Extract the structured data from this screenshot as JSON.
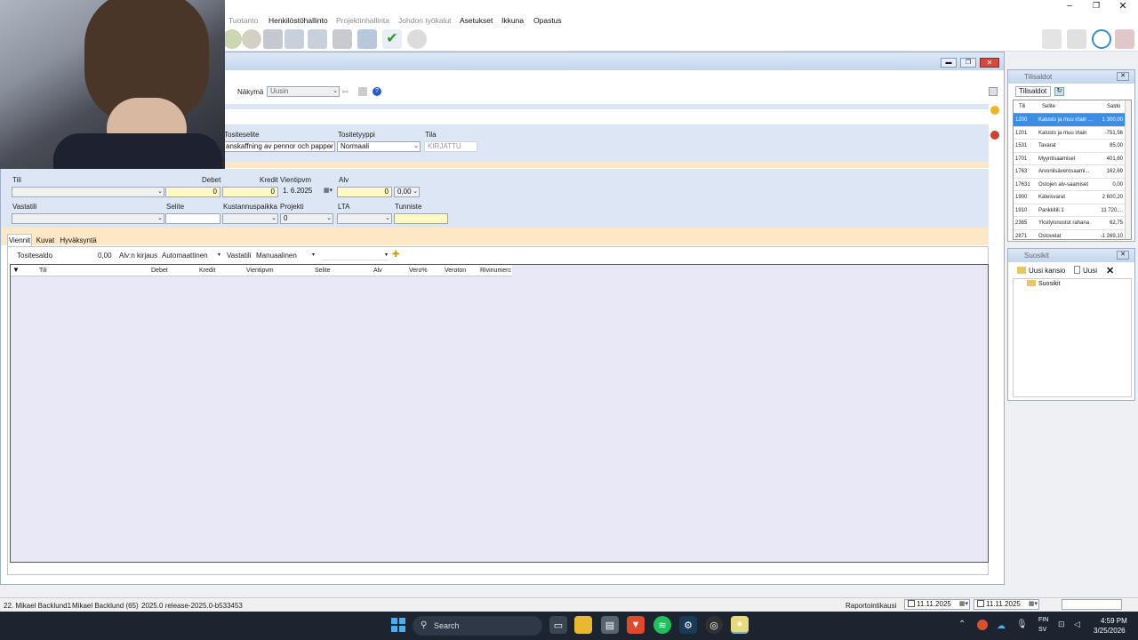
{
  "menu": [
    {
      "label": "Tuotanto",
      "enabled": false
    },
    {
      "label": "Henkilöstöhallinto",
      "enabled": true
    },
    {
      "label": "Projektinhallinta",
      "enabled": false
    },
    {
      "label": "Johdon työkalut",
      "enabled": false
    },
    {
      "label": "Asetukset",
      "enabled": true
    },
    {
      "label": "Ikkuna",
      "enabled": true
    },
    {
      "label": "Opastus",
      "enabled": true
    }
  ],
  "view": {
    "label": "Näkymä",
    "value": "Uusin"
  },
  "voucher": {
    "desc_label": "Tositeselite",
    "desc_value": "anskaffning av pennor och papper",
    "type_label": "Tositetyyppi",
    "type_value": "Normaali",
    "state_label": "Tila",
    "state_value": "KIRJATTU"
  },
  "entry": {
    "account_label": "Tili",
    "debit_label": "Debet",
    "debit_value": "0",
    "credit_label": "Kredit",
    "credit_value": "0",
    "date_label": "Vientipvm",
    "date_value": "1.  6.2025",
    "vat_label": "Alv",
    "vat_value": "0",
    "vat_pct": "0,00",
    "offset_label": "Vastatili",
    "desc_label": "Selite",
    "cost_center_label": "Kustannuspaikka",
    "project_label": "Projekti",
    "project_value": "0",
    "lta_label": "LTA",
    "tag_label": "Tunniste"
  },
  "tabs": [
    "Viennit",
    "Kuvat",
    "Hyväksyntä"
  ],
  "toolbar2": {
    "balance_label": "Tositesaldo",
    "balance_value": "0,00",
    "vat_posting_label": "Alv:n kirjaus",
    "vat_posting_value": "Automaattinen",
    "offset_label": "Vastatili",
    "offset_value": "Manuaalinen"
  },
  "grid_columns": [
    "Tili",
    "Debet",
    "Kredit",
    "Vientipvm",
    "Selite",
    "Alv",
    "Vero%",
    "Veroton",
    "Rivinumerc"
  ],
  "balances_panel": {
    "title": "Tilisaldot",
    "tab": "Tilisaldot",
    "columns": [
      "Tili",
      "Selite",
      "Saldo"
    ],
    "rows": [
      {
        "acc": "1200",
        "desc": "Kalusto ja muu irtain ...",
        "bal": "1 300,00",
        "selected": true
      },
      {
        "acc": "1201",
        "desc": "Kalusto ja muu irtain",
        "bal": "-751,56"
      },
      {
        "acc": "1531",
        "desc": "Tavarat",
        "bal": "85,00"
      },
      {
        "acc": "1701",
        "desc": "Myyntisaamiset",
        "bal": "401,60"
      },
      {
        "acc": "1763",
        "desc": "Arvonlisäverosaami...",
        "bal": "162,69"
      },
      {
        "acc": "17631",
        "desc": "Ostojen alv-saamiset",
        "bal": "0,00"
      },
      {
        "acc": "1900",
        "desc": "Käteisvarat",
        "bal": "2 600,20"
      },
      {
        "acc": "1910",
        "desc": "Pankkitili 1",
        "bal": "11 720,..."
      },
      {
        "acc": "2365",
        "desc": "Yksityisnostot rahana",
        "bal": "62,75"
      },
      {
        "acc": "2871",
        "desc": "Ostovelat",
        "bal": "-1 269,10"
      }
    ]
  },
  "favorites_panel": {
    "title": "Suosikit",
    "new_folder": "Uusi kansio",
    "new": "Uusi",
    "root": "Suosikit"
  },
  "status": {
    "user": "22. Mikael Backlund1",
    "user2": "Mikael Backlund (65)",
    "version": "2025.0 release-2025.0-b533453",
    "period_label": "Raportointikausi",
    "date1": "11.11.2025",
    "date2": "11.11.2025"
  },
  "taskbar": {
    "search": "Search",
    "lang1": "FIN",
    "lang2": "SV",
    "time": "4:59 PM",
    "date": "3/25/2026"
  },
  "colors": {
    "accent": "#0a64d8",
    "selected_row": "#3a8ee6",
    "entry_bg": "#dce6f4",
    "orange": "#fce8c4",
    "grid_bg": "#e8e8f6"
  }
}
